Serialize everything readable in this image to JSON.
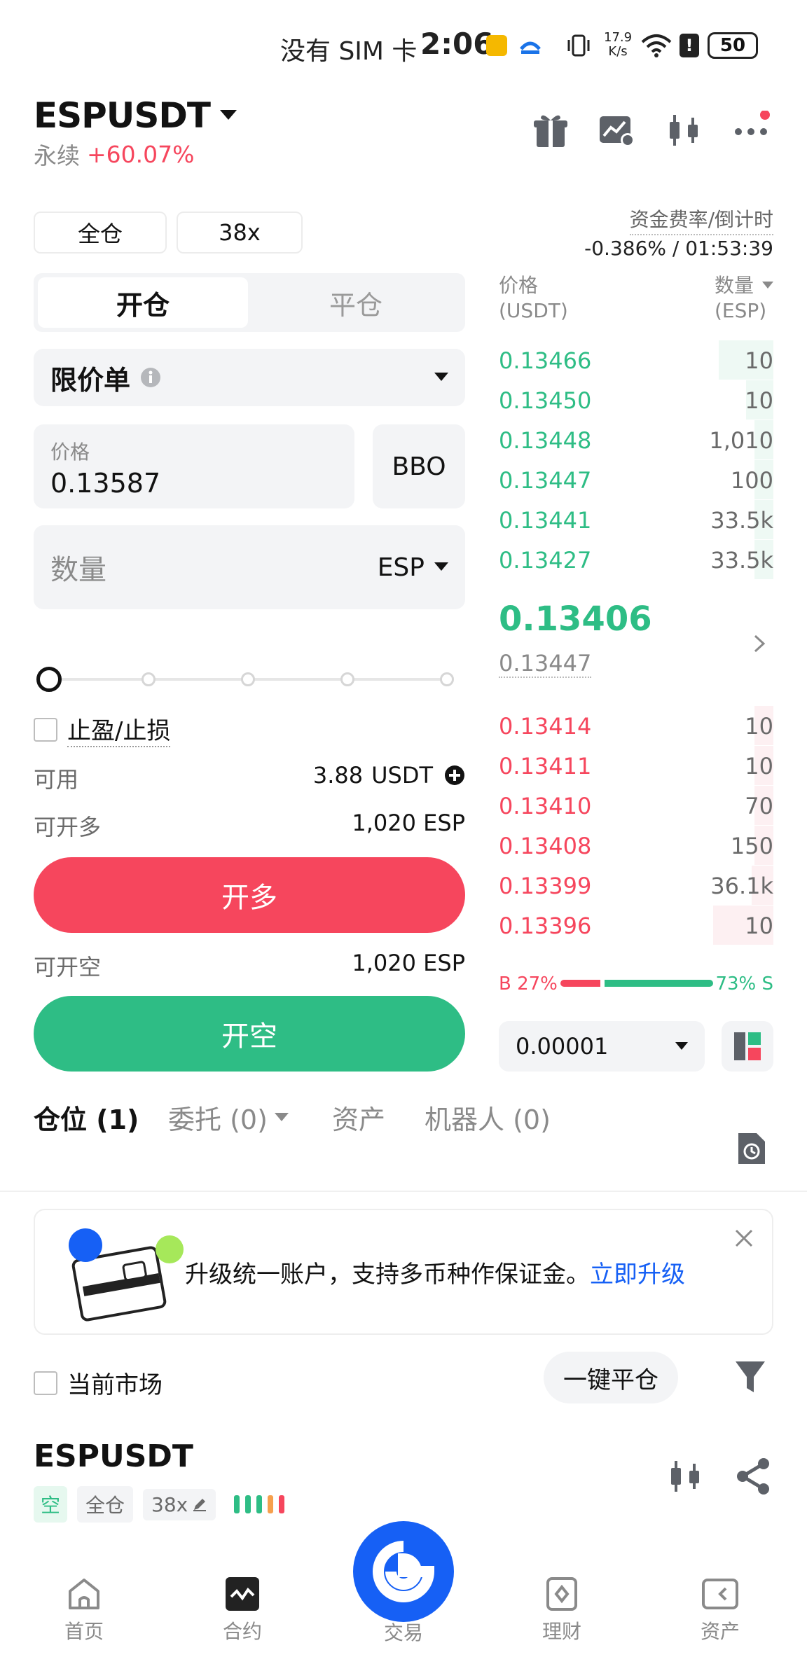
{
  "status_bar": {
    "carrier": "没有 SIM 卡",
    "time": "2:06",
    "net_speed": "17.9",
    "net_unit": "K/s",
    "battery": "50"
  },
  "header": {
    "pair": "ESPUSDT",
    "type": "永续",
    "change": "+60.07%"
  },
  "chips": {
    "margin_mode": "全仓",
    "leverage": "38x"
  },
  "funding": {
    "label": "资金费率/倒计时",
    "value": "-0.386% / 01:53:39"
  },
  "order_tabs": {
    "open": "开仓",
    "close": "平仓"
  },
  "order_type": {
    "label": "限价单"
  },
  "price_field": {
    "label": "价格",
    "value": "0.13587",
    "bbo": "BBO"
  },
  "qty_field": {
    "placeholder": "数量",
    "unit": "ESP"
  },
  "slider": {
    "value_fraction": 0
  },
  "tpsl": {
    "label": "止盈/止损"
  },
  "balance": {
    "available_label": "可用",
    "available_value": "3.88",
    "available_unit": "USDT",
    "long_label": "可开多",
    "long_value": "1,020 ESP",
    "short_label": "可开空",
    "short_value": "1,020 ESP"
  },
  "buttons": {
    "open_long": "开多",
    "open_short": "开空"
  },
  "orderbook": {
    "price_header": "价格",
    "price_unit": "(USDT)",
    "qty_header": "数量",
    "qty_unit": "(ESP)",
    "asks": [
      {
        "price": "0.13466",
        "qty": "10",
        "depth": 0.2
      },
      {
        "price": "0.13450",
        "qty": "10",
        "depth": 0.1
      },
      {
        "price": "0.13448",
        "qty": "1,010",
        "depth": 0.07
      },
      {
        "price": "0.13447",
        "qty": "100",
        "depth": 0.07
      },
      {
        "price": "0.13441",
        "qty": "33.5k",
        "depth": 0.07
      },
      {
        "price": "0.13427",
        "qty": "33.5k",
        "depth": 0.07
      }
    ],
    "last_price": "0.13406",
    "mark_price": "0.13447",
    "bids": [
      {
        "price": "0.13414",
        "qty": "10",
        "depth": 0.07
      },
      {
        "price": "0.13411",
        "qty": "10",
        "depth": 0.07
      },
      {
        "price": "0.13410",
        "qty": "70",
        "depth": 0.07
      },
      {
        "price": "0.13408",
        "qty": "150",
        "depth": 0.07
      },
      {
        "price": "0.13399",
        "qty": "36.1k",
        "depth": 0.08
      },
      {
        "price": "0.13396",
        "qty": "10",
        "depth": 0.22
      }
    ],
    "ratio_b": "B 27%",
    "ratio_s": "73% S",
    "ratio_b_fraction": 0.27,
    "precision": "0.00001"
  },
  "bottom_tabs": {
    "positions": "仓位 (1)",
    "orders": "委托 (0)",
    "assets": "资产",
    "bots": "机器人 (0)"
  },
  "banner": {
    "text": "升级统一账户，支持多币种作保证金。",
    "link": "立即升级"
  },
  "filter": {
    "current_market": "当前市场",
    "close_all": "一键平仓"
  },
  "position": {
    "pair": "ESPUSDT",
    "side": "空",
    "mode": "全仓",
    "leverage": "38x"
  },
  "nav": {
    "home": "首页",
    "futures": "合约",
    "trade": "交易",
    "earn": "理财",
    "assets": "资产"
  },
  "colors": {
    "green": "#2ebd85",
    "red": "#f6465d",
    "brand": "#1660f5"
  }
}
